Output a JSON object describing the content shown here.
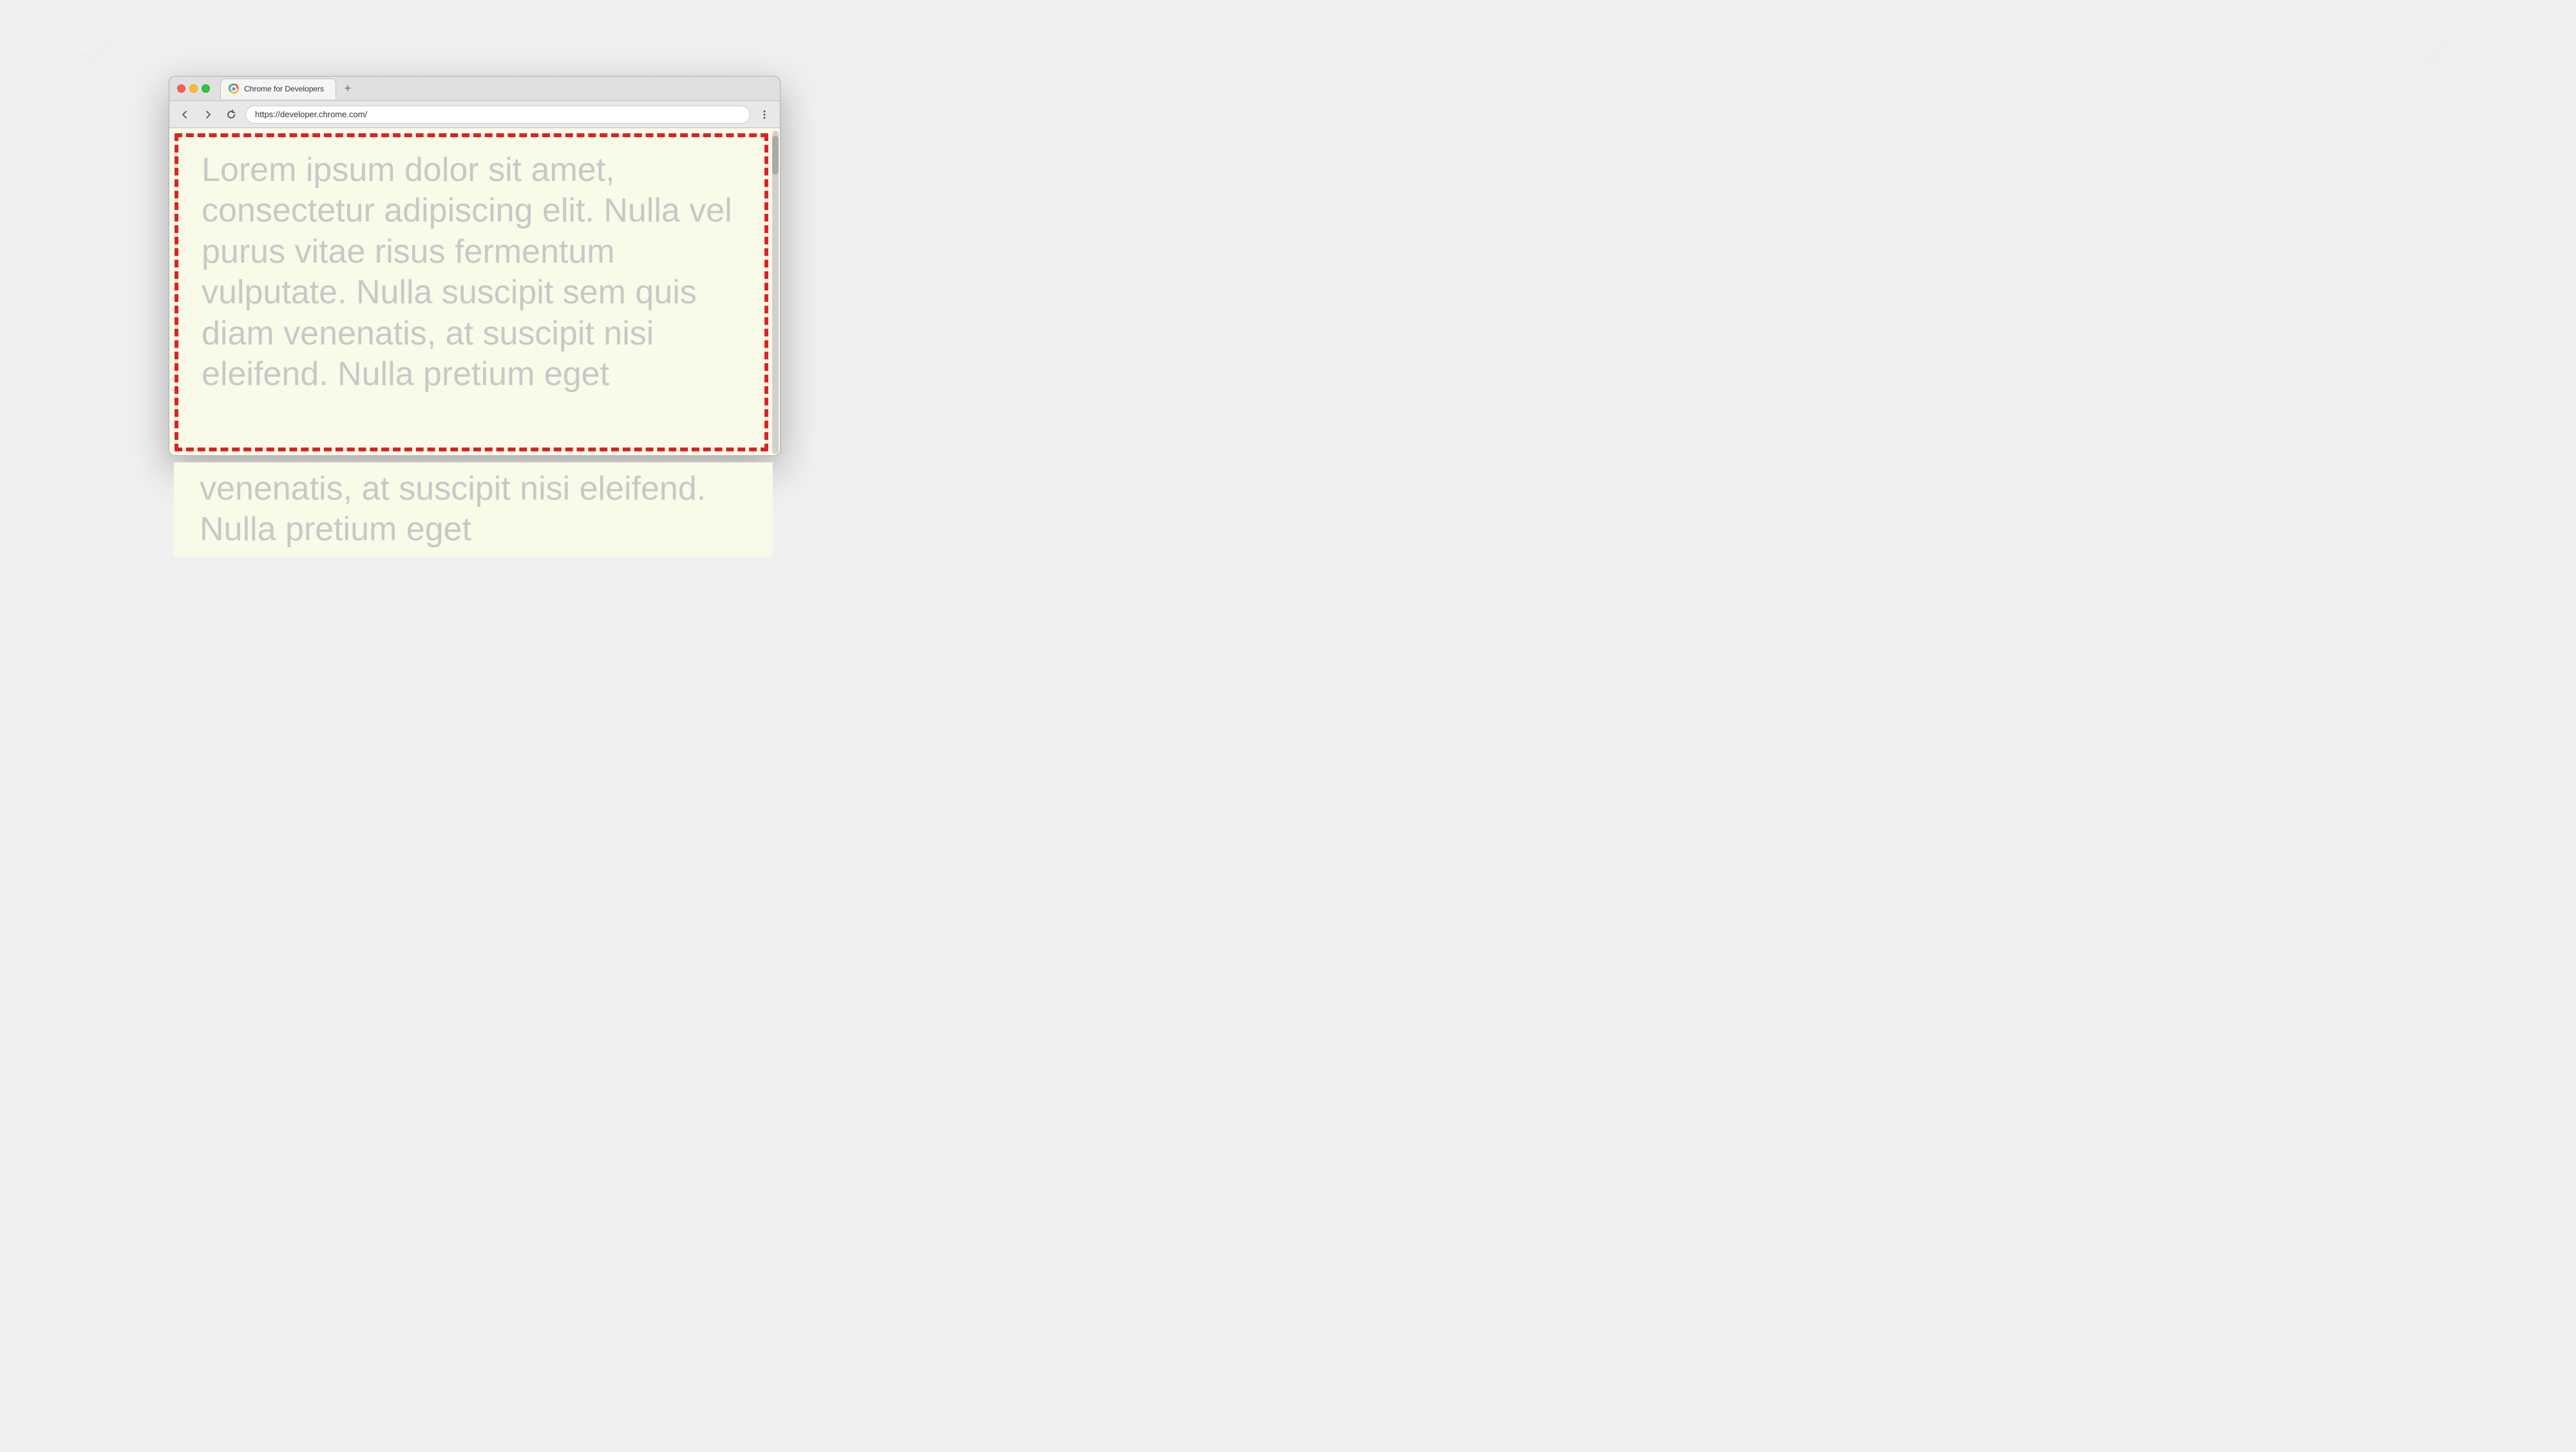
{
  "background": {
    "color": "#f0f0f0"
  },
  "browser": {
    "tab": {
      "title": "Chrome for Developers",
      "favicon": "chrome-logo"
    },
    "new_tab_label": "+",
    "address_bar": {
      "url": "https://developer.chrome.com/",
      "placeholder": "https://developer.chrome.com/"
    },
    "nav_buttons": {
      "back": "←",
      "forward": "→",
      "refresh": "↻",
      "menu": "⋮"
    }
  },
  "page": {
    "background": "#fafae8",
    "lorem_text": "Lorem ipsum dolor sit amet, consectetur adipiscing elit. Nulla vel purus vitae risus fermentum vulputate. Nulla suscipit sem quis diam venenatis, at suscipit nisi eleifend. Nulla pretium eget",
    "border_color": "#e02020",
    "text_color": "#c8c8c8"
  }
}
